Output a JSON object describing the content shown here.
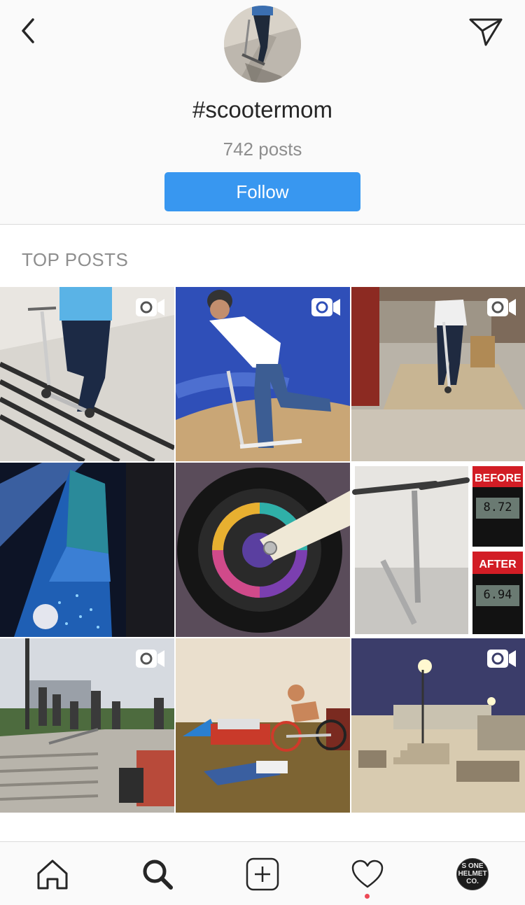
{
  "header": {
    "hashtag": "#scootermom",
    "post_count": "742 posts",
    "follow_label": "Follow",
    "back_icon": "chevron-left-icon",
    "share_icon": "paper-plane-icon"
  },
  "section": {
    "top_posts_label": "TOP POSTS"
  },
  "posts": [
    {
      "description": "person riding scooter on concrete plaza",
      "is_video": true
    },
    {
      "description": "rider with helmet on scooter, blue background",
      "is_video": true
    },
    {
      "description": "rider on scooter at indoor skatepark",
      "is_video": true
    },
    {
      "description": "painted galaxy scooter deck",
      "is_video": false
    },
    {
      "description": "rainbow oil-slick scooter wheel",
      "is_video": false
    },
    {
      "description": "scooter with before/after weight scale",
      "is_video": false,
      "overlay_texts": [
        "BEFORE",
        "AFTER",
        "8.72",
        "6.94"
      ]
    },
    {
      "description": "crowd at outdoor skatepark stairs",
      "is_video": true
    },
    {
      "description": "BMX rider jumping over person",
      "is_video": false
    },
    {
      "description": "skatepark at night",
      "is_video": true
    }
  ],
  "tabbar": {
    "items": [
      "home-icon",
      "search-icon",
      "add-post-icon",
      "activity-heart-icon",
      "profile-avatar"
    ],
    "active": "search-icon",
    "profile_text": "S ONE HELMET CO.",
    "notification_color": "#ed4956"
  },
  "colors": {
    "accent": "#3897f0",
    "muted_text": "#8e8e8e",
    "primary_text": "#262626"
  }
}
